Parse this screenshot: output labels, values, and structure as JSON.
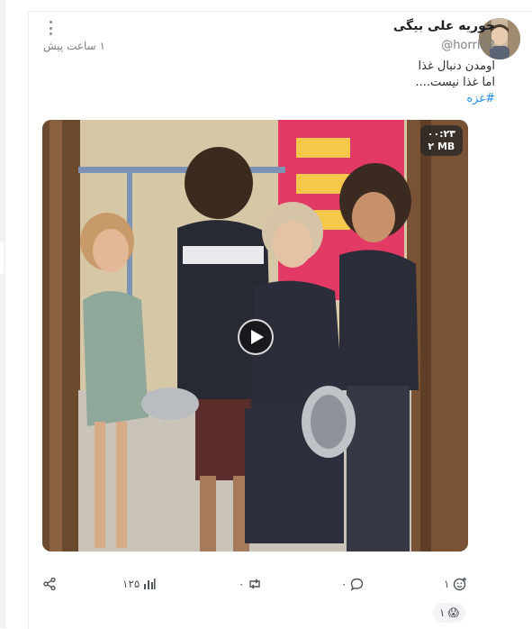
{
  "post": {
    "author_name": "حوریه علی بیگی",
    "author_handle": "@horri52",
    "timestamp": "۱ ساعت پیش",
    "text_lines": [
      "اومدن دنبال غذا",
      "اما غذا نیست...."
    ],
    "hashtag": "#غزه",
    "avatar_icon": "user-avatar-photo"
  },
  "media": {
    "duration": "۰۰:۲۳",
    "size": "۲ MB",
    "play_icon": "play-icon"
  },
  "actions": {
    "share_icon": "share-icon",
    "views_icon": "bar-chart-icon",
    "views_count": "۱۲۵",
    "repost_icon": "repost-icon",
    "repost_count": "۰",
    "reply_icon": "comment-icon",
    "reply_count": "۰",
    "react_icon": "add-reaction-icon",
    "react_count": "۱"
  },
  "reactions": [
    {
      "emoji": "😱",
      "count": "۱"
    }
  ],
  "colors": {
    "hashtag": "#1d8df0",
    "muted_text": "#7a7f87"
  }
}
